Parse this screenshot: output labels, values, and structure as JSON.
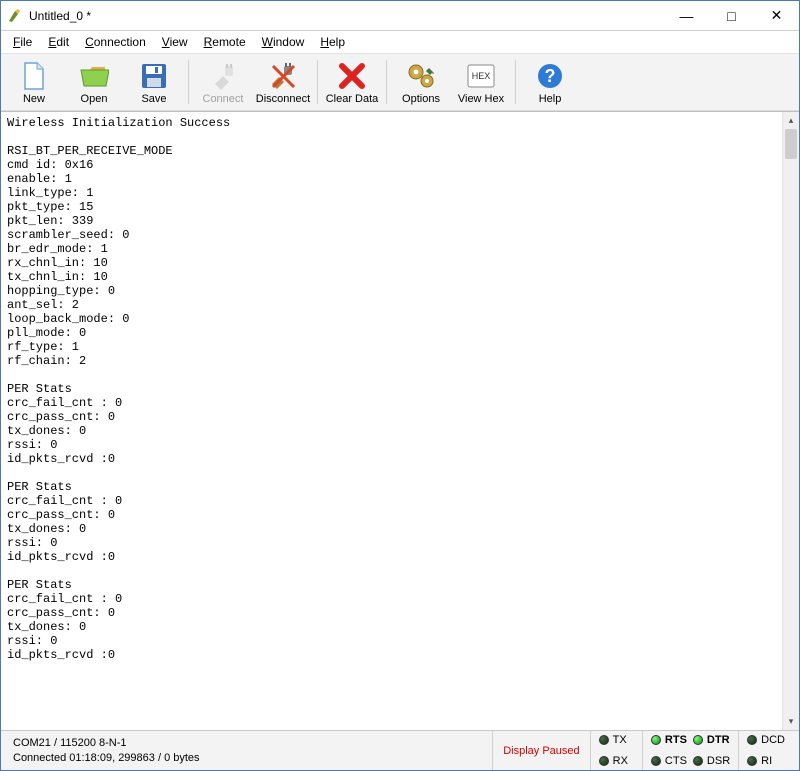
{
  "window": {
    "title": "Untitled_0 *"
  },
  "menu": {
    "file": "File",
    "edit": "Edit",
    "connection": "Connection",
    "view": "View",
    "remote": "Remote",
    "window": "Window",
    "help": "Help"
  },
  "toolbar": {
    "new": "New",
    "open": "Open",
    "save": "Save",
    "connect": "Connect",
    "disconnect": "Disconnect",
    "cleardata": "Clear Data",
    "options": "Options",
    "viewhex": "View Hex",
    "help": "Help"
  },
  "console_text": "Wireless Initialization Success\n\nRSI_BT_PER_RECEIVE_MODE\ncmd id: 0x16\nenable: 1\nlink_type: 1\npkt_type: 15\npkt_len: 339\nscrambler_seed: 0\nbr_edr_mode: 1\nrx_chnl_in: 10\ntx_chnl_in: 10\nhopping_type: 0\nant_sel: 2\nloop_back_mode: 0\npll_mode: 0\nrf_type: 1\nrf_chain: 2\n\nPER Stats\ncrc_fail_cnt : 0\ncrc_pass_cnt: 0\ntx_dones: 0\nrssi: 0\nid_pkts_rcvd :0\n\nPER Stats\ncrc_fail_cnt : 0\ncrc_pass_cnt: 0\ntx_dones: 0\nrssi: 0\nid_pkts_rcvd :0\n\nPER Stats\ncrc_fail_cnt : 0\ncrc_pass_cnt: 0\ntx_dones: 0\nrssi: 0\nid_pkts_rcvd :0",
  "status": {
    "port_line": "COM21 / 115200 8-N-1",
    "conn_line": "Connected 01:18:09, 299863 / 0 bytes",
    "paused": "Display Paused",
    "signals": {
      "tx": "TX",
      "rx": "RX",
      "rts": "RTS",
      "cts": "CTS",
      "dtr": "DTR",
      "dsr": "DSR",
      "dcd": "DCD",
      "ri": "RI"
    }
  }
}
